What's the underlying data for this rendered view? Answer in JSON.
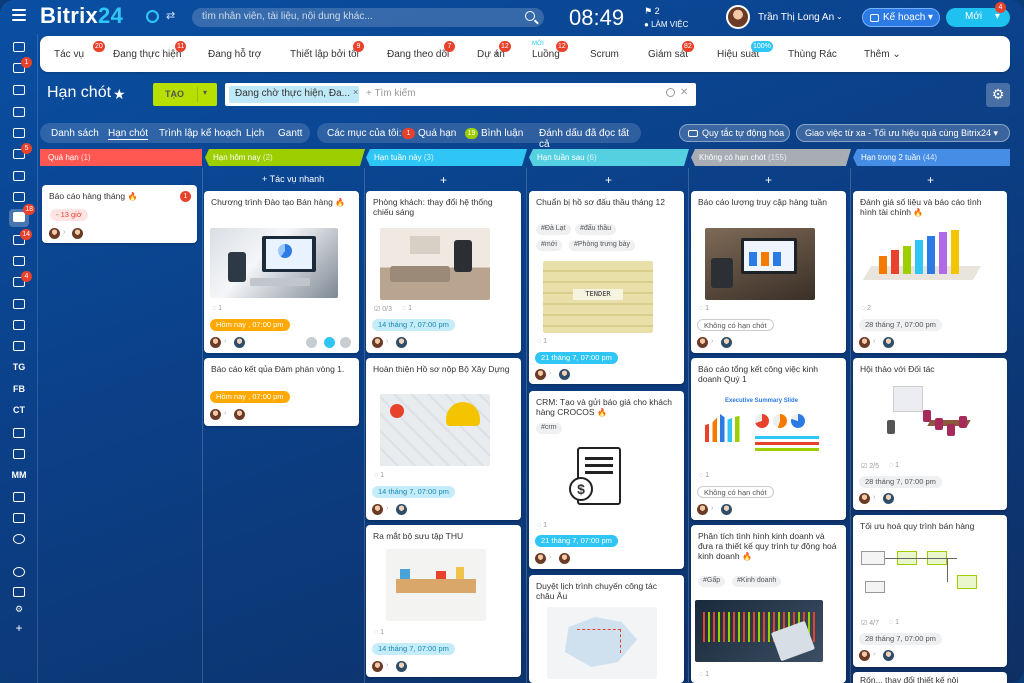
{
  "app": {
    "logo_text": "Bitrix",
    "logo_num": "24",
    "clock": "08:49",
    "flag_count": "2",
    "work_status": "LÀM VIỆC"
  },
  "search": {
    "placeholder": "tìm nhân viên, tài liệu, nội dung khác..."
  },
  "user": {
    "name": "Trần Thị Long An"
  },
  "header_buttons": {
    "plan": "Kế hoạch",
    "new": "Mới",
    "new_badge": "4"
  },
  "rail": {
    "badges": [
      "1",
      "5",
      "18",
      "14",
      "4"
    ],
    "labels": [
      "TG",
      "FB",
      "CT",
      "MM"
    ]
  },
  "tabs": [
    {
      "label": "Tác vụ",
      "badge": "20"
    },
    {
      "label": "Đang thực hiện",
      "badge": "11"
    },
    {
      "label": "Đang hỗ trợ",
      "badge": ""
    },
    {
      "label": "Thiết lập bởi tôi",
      "badge": "9"
    },
    {
      "label": "Đang theo dõi",
      "badge": "7"
    },
    {
      "label": "Dự án",
      "badge": "12"
    },
    {
      "label": "Luồng",
      "badge": "12",
      "new": "MỚI"
    },
    {
      "label": "Scrum",
      "badge": ""
    },
    {
      "label": "Giám sát",
      "badge": "82"
    },
    {
      "label": "Hiệu suất",
      "badge": "100%"
    },
    {
      "label": "Thùng Rác",
      "badge": ""
    },
    {
      "label": "Thêm",
      "badge": ""
    }
  ],
  "page": {
    "title": "Hạn chót",
    "create": "TẠO",
    "filter_chip": "Đang chờ thực hiện, Đa...",
    "filter_placeholder": "+ Tìm kiếm"
  },
  "views": [
    "Danh sách",
    "Hạn chót",
    "Trình lập kế hoạch",
    "Lịch",
    "Gantt"
  ],
  "counters": {
    "label": "Các mục của tôi:",
    "overdue_count": "1",
    "overdue": "Quá hạn",
    "comments_count": "19",
    "comments": "Bình luận",
    "mark_read": "Đánh dấu đã đọc tất cả"
  },
  "actions": {
    "auto_rules": "Quy tắc tự động hóa",
    "remote": "Giao việc từ xa - Tối ưu hiệu quả cùng Bitrix24"
  },
  "columns": [
    {
      "title": "Quá hạn",
      "count": "(1)",
      "color": "#ff5752"
    },
    {
      "title": "Hạn hôm nay",
      "count": "(2)",
      "color": "#9dcf00"
    },
    {
      "title": "Hạn tuần này",
      "count": "(3)",
      "color": "#2fc6f6"
    },
    {
      "title": "Hạn tuần sau",
      "count": "(6)",
      "color": "#55d0e0"
    },
    {
      "title": "Không có hạn chót",
      "count": "(155)",
      "color": "#a8adb4"
    },
    {
      "title": "Hạn trong 2 tuần",
      "count": "(44)",
      "color": "#468ee5"
    }
  ],
  "quick_task": "+ Tác vụ nhanh",
  "cards": {
    "c1": {
      "title": "Báo cáo hàng tháng",
      "deadline": "- 13 giờ",
      "badge": "1"
    },
    "c2": {
      "title": "Chương trình Đào tạo Bán hàng",
      "count": "1",
      "deadline": "Hôm nay , 07:00 pm"
    },
    "c3": {
      "title": "Báo cáo kết qủa Đàm phán vòng 1.",
      "deadline": "Hôm nay , 07:00 pm"
    },
    "c4": {
      "title": "Phòng khách: thay đổi hệ thống chiếu sáng",
      "checklist": "0/3",
      "count": "1",
      "deadline": "14 tháng 7, 07:00 pm"
    },
    "c5": {
      "title": "Hoàn thiện Hồ sơ nộp Bộ Xây Dựng",
      "count": "1",
      "deadline": "14 tháng 7, 07:00 pm"
    },
    "c6": {
      "title": "Ra mắt bộ sưu tập THU",
      "count": "1",
      "deadline": "14 tháng 7, 07:00 pm"
    },
    "c7": {
      "title": "Chuẩn bị hồ sơ đấu thầu tháng 12",
      "tags": [
        "#Đà Lạt",
        "#đấu thầu",
        "#mới",
        "#Phòng trưng bày"
      ],
      "count": "1",
      "deadline": "21 tháng 7, 07:00 pm",
      "image_text": "TENDER"
    },
    "c8": {
      "title": "CRM: Tạo và gửi báo giá cho khách hàng CROCOS",
      "tags": [
        "#crm"
      ],
      "count": "1",
      "deadline": "21 tháng 7, 07:00 pm"
    },
    "c9": {
      "title": "Duyệt lịch trình chuyến công tác châu Âu"
    },
    "c10": {
      "title": "Báo cáo lượng truy cập hàng tuần",
      "count": "1",
      "deadline": "Không có hạn chót"
    },
    "c11": {
      "title": "Báo cáo tổng kết công việc kinh doanh Quý 1",
      "count": "1",
      "deadline": "Không có hạn chót",
      "slide_title": "Executive Summary Slide"
    },
    "c12": {
      "title": "Phân tích tình hình kinh doanh và đưa ra thiết kế quy trình tự động hoá kinh doanh",
      "tags": [
        "#Gấp",
        "#Kinh doanh"
      ],
      "count": "1"
    },
    "c13": {
      "title": "Đánh giá số liệu và báo cáo tình hình tài chính",
      "count": "2",
      "deadline": "28 tháng 7, 07:00 pm"
    },
    "c14": {
      "title": "Hội thảo với Đối tác",
      "checklist": "2/5",
      "count": "1",
      "deadline": "28 tháng 7, 07:00 pm"
    },
    "c15": {
      "title": "Tối ưu hoá quy trình bán hàng",
      "checklist": "4/7",
      "count": "1",
      "deadline": "28 tháng 7, 07:00 pm"
    },
    "c16": {
      "title": "Rốn... thay đổi thiết kế nội"
    }
  }
}
